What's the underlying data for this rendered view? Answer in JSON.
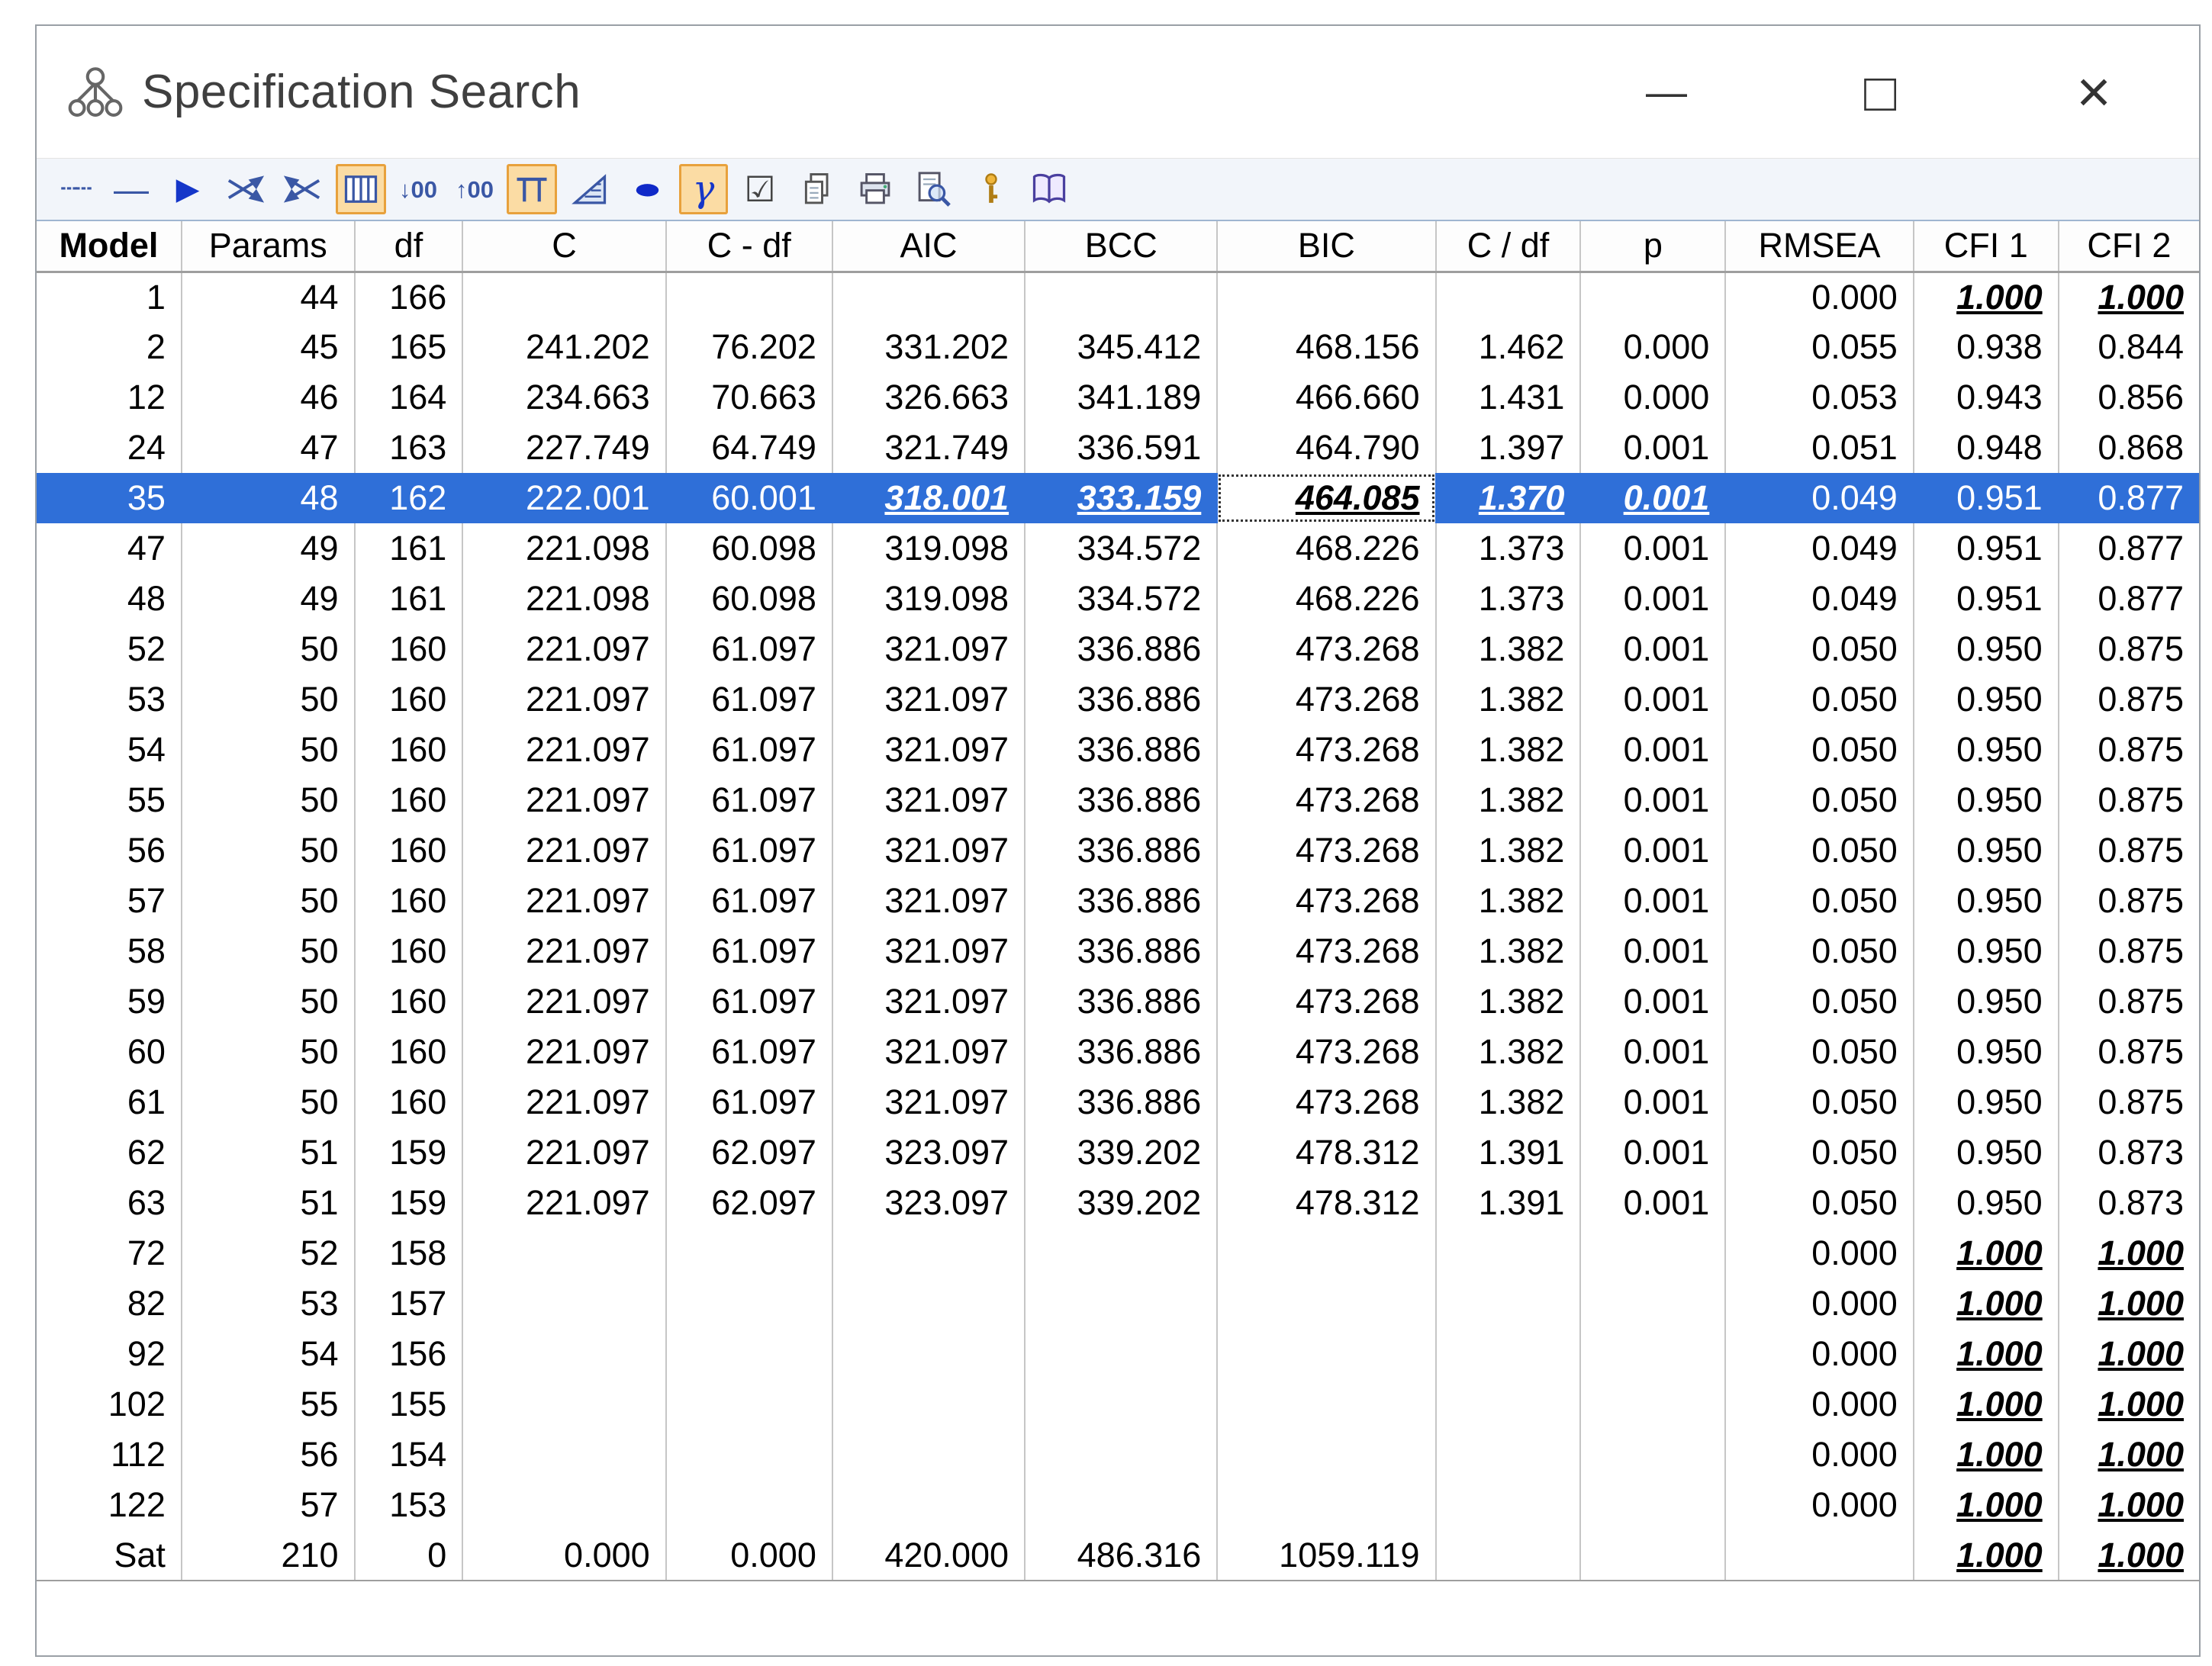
{
  "window": {
    "title": "Specification Search",
    "icon": "path-diagram-icon",
    "controls": [
      {
        "name": "minimize-button",
        "glyph": "—"
      },
      {
        "name": "maximize-button",
        "glyph": "□"
      },
      {
        "name": "close-button",
        "glyph": "×"
      }
    ]
  },
  "toolbar": {
    "buttons": [
      {
        "name": "optional-arrow-icon",
        "glyph": "┄┄",
        "toggled": false
      },
      {
        "name": "required-arrow-icon",
        "glyph": "—",
        "toggled": false
      },
      {
        "name": "perform-search-icon",
        "glyph": "▶",
        "toggled": false
      },
      {
        "name": "swap-arrows-icon",
        "svg": true,
        "toggled": false
      },
      {
        "name": "swap-arrows-alt-icon",
        "svg": true,
        "toggled": false
      },
      {
        "name": "show-summary-icon",
        "svg": true,
        "toggled": true
      },
      {
        "name": "decrease-decimal-icon",
        "glyph": "↓00",
        "toggled": false
      },
      {
        "name": "increase-decimal-icon",
        "glyph": "↑00",
        "toggled": false
      },
      {
        "name": "short-list-icon",
        "svg": true,
        "toggled": true
      },
      {
        "name": "scatterplot-icon",
        "svg": true,
        "toggled": false
      },
      {
        "name": "ellipse-icon",
        "glyph": "●",
        "toggled": false
      },
      {
        "name": "gamma-icon",
        "glyph": "γ",
        "toggled": true
      },
      {
        "name": "options-checkbox-icon",
        "glyph": "☑",
        "toggled": false
      },
      {
        "name": "copy-icon",
        "svg": true,
        "toggled": false
      },
      {
        "name": "print-icon",
        "svg": true,
        "toggled": false
      },
      {
        "name": "print-preview-icon",
        "svg": true,
        "toggled": false
      },
      {
        "name": "info-icon",
        "svg": true,
        "toggled": false
      },
      {
        "name": "help-book-icon",
        "svg": true,
        "toggled": false
      }
    ]
  },
  "table": {
    "columns": [
      {
        "key": "model",
        "label": "Model",
        "bold": true
      },
      {
        "key": "params",
        "label": "Params"
      },
      {
        "key": "df",
        "label": "df"
      },
      {
        "key": "c",
        "label": "C"
      },
      {
        "key": "cdf",
        "label": "C - df"
      },
      {
        "key": "aic",
        "label": "AIC"
      },
      {
        "key": "bcc",
        "label": "BCC"
      },
      {
        "key": "bic",
        "label": "BIC"
      },
      {
        "key": "coverdf",
        "label": "C / df"
      },
      {
        "key": "p",
        "label": "p"
      },
      {
        "key": "rmsea",
        "label": "RMSEA"
      },
      {
        "key": "cfi1",
        "label": "CFI 1"
      },
      {
        "key": "cfi2",
        "label": "CFI 2"
      }
    ],
    "selected_model": "35",
    "focused_column": "bic",
    "rows": [
      {
        "cells": {
          "model": "1",
          "params": "44",
          "df": "166",
          "c": "",
          "cdf": "",
          "aic": "",
          "bcc": "",
          "bic": "",
          "coverdf": "",
          "p": "",
          "rmsea": "0.000",
          "cfi1": "1.000",
          "cfi2": "1.000"
        },
        "em": [
          "cfi1",
          "cfi2"
        ]
      },
      {
        "cells": {
          "model": "2",
          "params": "45",
          "df": "165",
          "c": "241.202",
          "cdf": "76.202",
          "aic": "331.202",
          "bcc": "345.412",
          "bic": "468.156",
          "coverdf": "1.462",
          "p": "0.000",
          "rmsea": "0.055",
          "cfi1": "0.938",
          "cfi2": "0.844"
        }
      },
      {
        "cells": {
          "model": "12",
          "params": "46",
          "df": "164",
          "c": "234.663",
          "cdf": "70.663",
          "aic": "326.663",
          "bcc": "341.189",
          "bic": "466.660",
          "coverdf": "1.431",
          "p": "0.000",
          "rmsea": "0.053",
          "cfi1": "0.943",
          "cfi2": "0.856"
        }
      },
      {
        "cells": {
          "model": "24",
          "params": "47",
          "df": "163",
          "c": "227.749",
          "cdf": "64.749",
          "aic": "321.749",
          "bcc": "336.591",
          "bic": "464.790",
          "coverdf": "1.397",
          "p": "0.001",
          "rmsea": "0.051",
          "cfi1": "0.948",
          "cfi2": "0.868"
        }
      },
      {
        "cells": {
          "model": "35",
          "params": "48",
          "df": "162",
          "c": "222.001",
          "cdf": "60.001",
          "aic": "318.001",
          "bcc": "333.159",
          "bic": "464.085",
          "coverdf": "1.370",
          "p": "0.001",
          "rmsea": "0.049",
          "cfi1": "0.951",
          "cfi2": "0.877"
        },
        "em": [
          "aic",
          "bcc",
          "bic",
          "coverdf",
          "p"
        ],
        "selected": true,
        "focus": "bic"
      },
      {
        "cells": {
          "model": "47",
          "params": "49",
          "df": "161",
          "c": "221.098",
          "cdf": "60.098",
          "aic": "319.098",
          "bcc": "334.572",
          "bic": "468.226",
          "coverdf": "1.373",
          "p": "0.001",
          "rmsea": "0.049",
          "cfi1": "0.951",
          "cfi2": "0.877"
        }
      },
      {
        "cells": {
          "model": "48",
          "params": "49",
          "df": "161",
          "c": "221.098",
          "cdf": "60.098",
          "aic": "319.098",
          "bcc": "334.572",
          "bic": "468.226",
          "coverdf": "1.373",
          "p": "0.001",
          "rmsea": "0.049",
          "cfi1": "0.951",
          "cfi2": "0.877"
        }
      },
      {
        "cells": {
          "model": "52",
          "params": "50",
          "df": "160",
          "c": "221.097",
          "cdf": "61.097",
          "aic": "321.097",
          "bcc": "336.886",
          "bic": "473.268",
          "coverdf": "1.382",
          "p": "0.001",
          "rmsea": "0.050",
          "cfi1": "0.950",
          "cfi2": "0.875"
        }
      },
      {
        "cells": {
          "model": "53",
          "params": "50",
          "df": "160",
          "c": "221.097",
          "cdf": "61.097",
          "aic": "321.097",
          "bcc": "336.886",
          "bic": "473.268",
          "coverdf": "1.382",
          "p": "0.001",
          "rmsea": "0.050",
          "cfi1": "0.950",
          "cfi2": "0.875"
        }
      },
      {
        "cells": {
          "model": "54",
          "params": "50",
          "df": "160",
          "c": "221.097",
          "cdf": "61.097",
          "aic": "321.097",
          "bcc": "336.886",
          "bic": "473.268",
          "coverdf": "1.382",
          "p": "0.001",
          "rmsea": "0.050",
          "cfi1": "0.950",
          "cfi2": "0.875"
        }
      },
      {
        "cells": {
          "model": "55",
          "params": "50",
          "df": "160",
          "c": "221.097",
          "cdf": "61.097",
          "aic": "321.097",
          "bcc": "336.886",
          "bic": "473.268",
          "coverdf": "1.382",
          "p": "0.001",
          "rmsea": "0.050",
          "cfi1": "0.950",
          "cfi2": "0.875"
        }
      },
      {
        "cells": {
          "model": "56",
          "params": "50",
          "df": "160",
          "c": "221.097",
          "cdf": "61.097",
          "aic": "321.097",
          "bcc": "336.886",
          "bic": "473.268",
          "coverdf": "1.382",
          "p": "0.001",
          "rmsea": "0.050",
          "cfi1": "0.950",
          "cfi2": "0.875"
        }
      },
      {
        "cells": {
          "model": "57",
          "params": "50",
          "df": "160",
          "c": "221.097",
          "cdf": "61.097",
          "aic": "321.097",
          "bcc": "336.886",
          "bic": "473.268",
          "coverdf": "1.382",
          "p": "0.001",
          "rmsea": "0.050",
          "cfi1": "0.950",
          "cfi2": "0.875"
        }
      },
      {
        "cells": {
          "model": "58",
          "params": "50",
          "df": "160",
          "c": "221.097",
          "cdf": "61.097",
          "aic": "321.097",
          "bcc": "336.886",
          "bic": "473.268",
          "coverdf": "1.382",
          "p": "0.001",
          "rmsea": "0.050",
          "cfi1": "0.950",
          "cfi2": "0.875"
        }
      },
      {
        "cells": {
          "model": "59",
          "params": "50",
          "df": "160",
          "c": "221.097",
          "cdf": "61.097",
          "aic": "321.097",
          "bcc": "336.886",
          "bic": "473.268",
          "coverdf": "1.382",
          "p": "0.001",
          "rmsea": "0.050",
          "cfi1": "0.950",
          "cfi2": "0.875"
        }
      },
      {
        "cells": {
          "model": "60",
          "params": "50",
          "df": "160",
          "c": "221.097",
          "cdf": "61.097",
          "aic": "321.097",
          "bcc": "336.886",
          "bic": "473.268",
          "coverdf": "1.382",
          "p": "0.001",
          "rmsea": "0.050",
          "cfi1": "0.950",
          "cfi2": "0.875"
        }
      },
      {
        "cells": {
          "model": "61",
          "params": "50",
          "df": "160",
          "c": "221.097",
          "cdf": "61.097",
          "aic": "321.097",
          "bcc": "336.886",
          "bic": "473.268",
          "coverdf": "1.382",
          "p": "0.001",
          "rmsea": "0.050",
          "cfi1": "0.950",
          "cfi2": "0.875"
        }
      },
      {
        "cells": {
          "model": "62",
          "params": "51",
          "df": "159",
          "c": "221.097",
          "cdf": "62.097",
          "aic": "323.097",
          "bcc": "339.202",
          "bic": "478.312",
          "coverdf": "1.391",
          "p": "0.001",
          "rmsea": "0.050",
          "cfi1": "0.950",
          "cfi2": "0.873"
        }
      },
      {
        "cells": {
          "model": "63",
          "params": "51",
          "df": "159",
          "c": "221.097",
          "cdf": "62.097",
          "aic": "323.097",
          "bcc": "339.202",
          "bic": "478.312",
          "coverdf": "1.391",
          "p": "0.001",
          "rmsea": "0.050",
          "cfi1": "0.950",
          "cfi2": "0.873"
        }
      },
      {
        "cells": {
          "model": "72",
          "params": "52",
          "df": "158",
          "c": "",
          "cdf": "",
          "aic": "",
          "bcc": "",
          "bic": "",
          "coverdf": "",
          "p": "",
          "rmsea": "0.000",
          "cfi1": "1.000",
          "cfi2": "1.000"
        },
        "em": [
          "cfi1",
          "cfi2"
        ]
      },
      {
        "cells": {
          "model": "82",
          "params": "53",
          "df": "157",
          "c": "",
          "cdf": "",
          "aic": "",
          "bcc": "",
          "bic": "",
          "coverdf": "",
          "p": "",
          "rmsea": "0.000",
          "cfi1": "1.000",
          "cfi2": "1.000"
        },
        "em": [
          "cfi1",
          "cfi2"
        ]
      },
      {
        "cells": {
          "model": "92",
          "params": "54",
          "df": "156",
          "c": "",
          "cdf": "",
          "aic": "",
          "bcc": "",
          "bic": "",
          "coverdf": "",
          "p": "",
          "rmsea": "0.000",
          "cfi1": "1.000",
          "cfi2": "1.000"
        },
        "em": [
          "cfi1",
          "cfi2"
        ]
      },
      {
        "cells": {
          "model": "102",
          "params": "55",
          "df": "155",
          "c": "",
          "cdf": "",
          "aic": "",
          "bcc": "",
          "bic": "",
          "coverdf": "",
          "p": "",
          "rmsea": "0.000",
          "cfi1": "1.000",
          "cfi2": "1.000"
        },
        "em": [
          "cfi1",
          "cfi2"
        ]
      },
      {
        "cells": {
          "model": "112",
          "params": "56",
          "df": "154",
          "c": "",
          "cdf": "",
          "aic": "",
          "bcc": "",
          "bic": "",
          "coverdf": "",
          "p": "",
          "rmsea": "0.000",
          "cfi1": "1.000",
          "cfi2": "1.000"
        },
        "em": [
          "cfi1",
          "cfi2"
        ]
      },
      {
        "cells": {
          "model": "122",
          "params": "57",
          "df": "153",
          "c": "",
          "cdf": "",
          "aic": "",
          "bcc": "",
          "bic": "",
          "coverdf": "",
          "p": "",
          "rmsea": "0.000",
          "cfi1": "1.000",
          "cfi2": "1.000"
        },
        "em": [
          "cfi1",
          "cfi2"
        ]
      },
      {
        "cells": {
          "model": "Sat",
          "params": "210",
          "df": "0",
          "c": "0.000",
          "cdf": "0.000",
          "aic": "420.000",
          "bcc": "486.316",
          "bic": "1059.119",
          "coverdf": "",
          "p": "",
          "rmsea": "",
          "cfi1": "1.000",
          "cfi2": "1.000"
        },
        "em": [
          "cfi1",
          "cfi2"
        ]
      }
    ]
  },
  "colors": {
    "selection": "#2f6fd8",
    "toggle_bg": "#fbdca4",
    "toggle_border": "#e8a13c",
    "gridline": "#c6c6c6"
  }
}
